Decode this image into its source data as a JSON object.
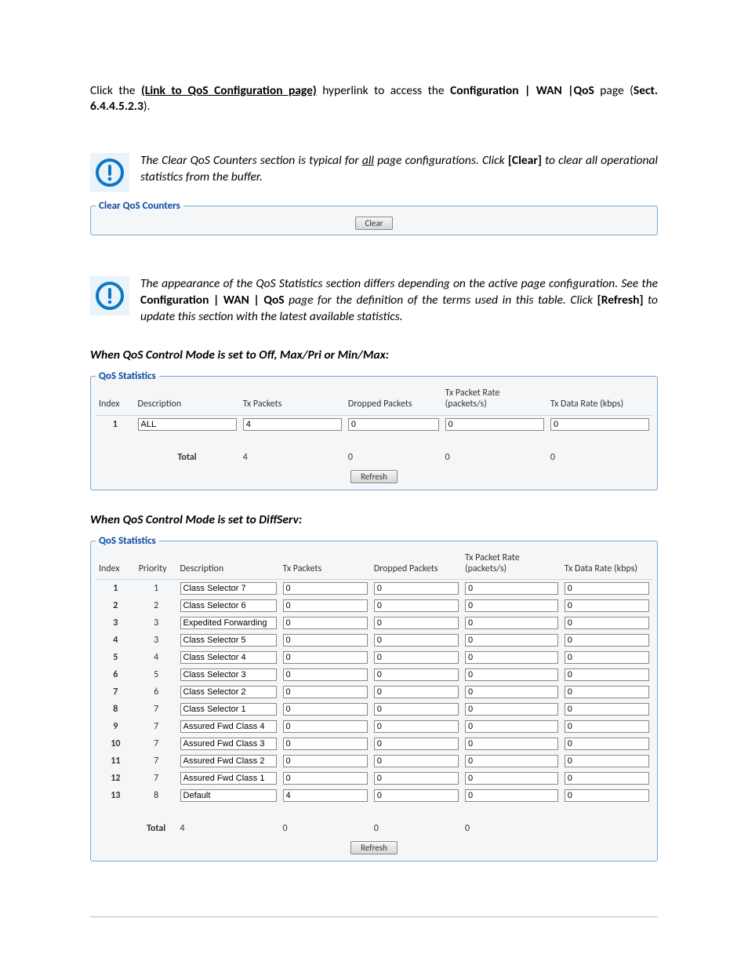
{
  "intro": {
    "prefix": "Click the ",
    "link": "(Link to QoS Configuration page)",
    "mid": " hyperlink to access the ",
    "target": "Configuration | WAN |QoS",
    "mid2": " page (",
    "sect": "Sect. 6.4.4.5.2.3",
    "suffix": ")."
  },
  "tip1": {
    "p1a": "The Clear QoS Counters section is typical for ",
    "p1u": "all",
    "p1b": " page configurations. Click ",
    "btn": "[Clear]",
    "p1c": " to clear all operational statistics from the buffer."
  },
  "clear_section": {
    "legend": "Clear QoS Counters",
    "button": "Clear"
  },
  "tip2": {
    "p1": "The appearance of the QoS Statistics section differs depending on the active page configuration. See the ",
    "bold1": "Configuration | WAN | QoS",
    "p2": " page for the definition of the terms used in this table. Click ",
    "btn": "[Refresh]",
    "p3": " to update this section with the latest available statistics."
  },
  "mode_off": {
    "heading": "When QoS Control Mode is set to Off, Max/Pri or Min/Max:",
    "legend": "QoS Statistics",
    "cols": [
      "Index",
      "Description",
      "Tx Packets",
      "Dropped Packets",
      "Tx Packet Rate (packets/s)",
      "Tx Data Rate (kbps)"
    ],
    "rows": [
      {
        "idx": "1",
        "desc": "ALL",
        "tx": "4",
        "dp": "0",
        "pr": "0",
        "dr": "0"
      }
    ],
    "total": {
      "label": "Total",
      "tx": "4",
      "dp": "0",
      "pr": "0",
      "dr": "0"
    },
    "refresh": "Refresh"
  },
  "mode_diffserv": {
    "heading": "When QoS Control Mode is set to DiffServ:",
    "legend": "QoS Statistics",
    "cols": [
      "Index",
      "Priority",
      "Description",
      "Tx Packets",
      "Dropped Packets",
      "Tx Packet Rate (packets/s)",
      "Tx Data Rate (kbps)"
    ],
    "rows": [
      {
        "idx": "1",
        "pri": "1",
        "desc": "Class Selector 7",
        "tx": "0",
        "dp": "0",
        "pr": "0",
        "dr": "0"
      },
      {
        "idx": "2",
        "pri": "2",
        "desc": "Class Selector 6",
        "tx": "0",
        "dp": "0",
        "pr": "0",
        "dr": "0"
      },
      {
        "idx": "3",
        "pri": "3",
        "desc": "Expedited Forwarding",
        "tx": "0",
        "dp": "0",
        "pr": "0",
        "dr": "0"
      },
      {
        "idx": "4",
        "pri": "3",
        "desc": "Class Selector 5",
        "tx": "0",
        "dp": "0",
        "pr": "0",
        "dr": "0"
      },
      {
        "idx": "5",
        "pri": "4",
        "desc": "Class Selector 4",
        "tx": "0",
        "dp": "0",
        "pr": "0",
        "dr": "0"
      },
      {
        "idx": "6",
        "pri": "5",
        "desc": "Class Selector 3",
        "tx": "0",
        "dp": "0",
        "pr": "0",
        "dr": "0"
      },
      {
        "idx": "7",
        "pri": "6",
        "desc": "Class Selector 2",
        "tx": "0",
        "dp": "0",
        "pr": "0",
        "dr": "0"
      },
      {
        "idx": "8",
        "pri": "7",
        "desc": "Class Selector 1",
        "tx": "0",
        "dp": "0",
        "pr": "0",
        "dr": "0"
      },
      {
        "idx": "9",
        "pri": "7",
        "desc": "Assured Fwd Class 4",
        "tx": "0",
        "dp": "0",
        "pr": "0",
        "dr": "0"
      },
      {
        "idx": "10",
        "pri": "7",
        "desc": "Assured Fwd Class 3",
        "tx": "0",
        "dp": "0",
        "pr": "0",
        "dr": "0"
      },
      {
        "idx": "11",
        "pri": "7",
        "desc": "Assured Fwd Class 2",
        "tx": "0",
        "dp": "0",
        "pr": "0",
        "dr": "0"
      },
      {
        "idx": "12",
        "pri": "7",
        "desc": "Assured Fwd Class 1",
        "tx": "0",
        "dp": "0",
        "pr": "0",
        "dr": "0"
      },
      {
        "idx": "13",
        "pri": "8",
        "desc": "Default",
        "tx": "4",
        "dp": "0",
        "pr": "0",
        "dr": "0"
      }
    ],
    "total": {
      "label": "Total",
      "tx": "4",
      "dp": "0",
      "pr": "0",
      "dr": "0"
    },
    "refresh": "Refresh"
  }
}
